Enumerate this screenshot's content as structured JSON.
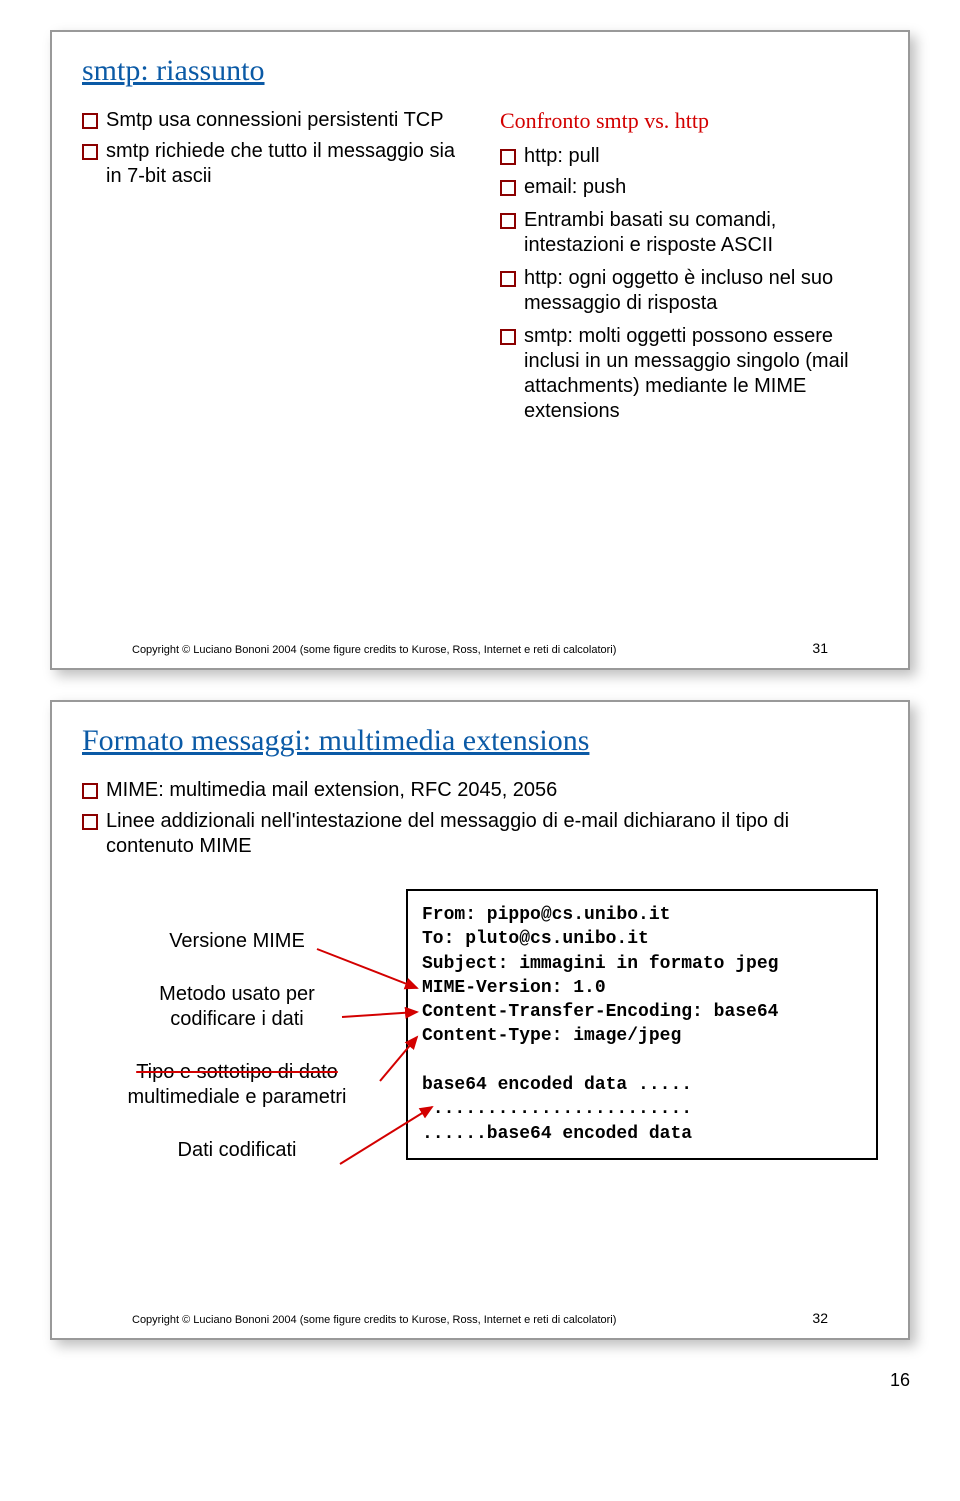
{
  "slide1": {
    "title": "smtp: riassunto",
    "left": [
      "Smtp usa connessioni persistenti TCP",
      "smtp richiede che tutto il messaggio sia in 7-bit ascii"
    ],
    "right_heading": "Confronto smtp vs. http",
    "right": [
      "http: pull",
      "email: push",
      "Entrambi basati su comandi, intestazioni e risposte ASCII",
      "http: ogni oggetto è incluso nel suo messaggio di risposta",
      "smtp: molti oggetti possono essere inclusi in un messaggio singolo (mail attachments) mediante le MIME extensions"
    ],
    "copyright": "Copyright © Luciano Bononi 2004 (some figure credits to Kurose, Ross, Internet e reti di calcolatori)",
    "num": "31"
  },
  "slide2": {
    "title": "Formato messaggi: multimedia extensions",
    "top": [
      "MIME: multimedia mail extension, RFC 2045, 2056",
      "Linee addizionali nell'intestazione del messaggio di e-mail dichiarano il tipo di contenuto MIME"
    ],
    "labels": {
      "l1": "Versione MIME",
      "l2a": "Metodo usato per",
      "l2b": "codificare i dati",
      "l3a": "Tipo e sottotipo di dato",
      "l3b": "multimediale e parametri",
      "l4": "Dati codificati"
    },
    "code": "From: pippo@cs.unibo.it\nTo: pluto@cs.unibo.it\nSubject: immagini in formato jpeg\nMIME-Version: 1.0\nContent-Transfer-Encoding: base64\nContent-Type: image/jpeg\n\nbase64 encoded data .....\n.........................\n......base64 encoded data",
    "copyright": "Copyright © Luciano Bononi 2004 (some figure credits to Kurose, Ross, Internet e reti di calcolatori)",
    "num": "32"
  },
  "page_num": "16"
}
